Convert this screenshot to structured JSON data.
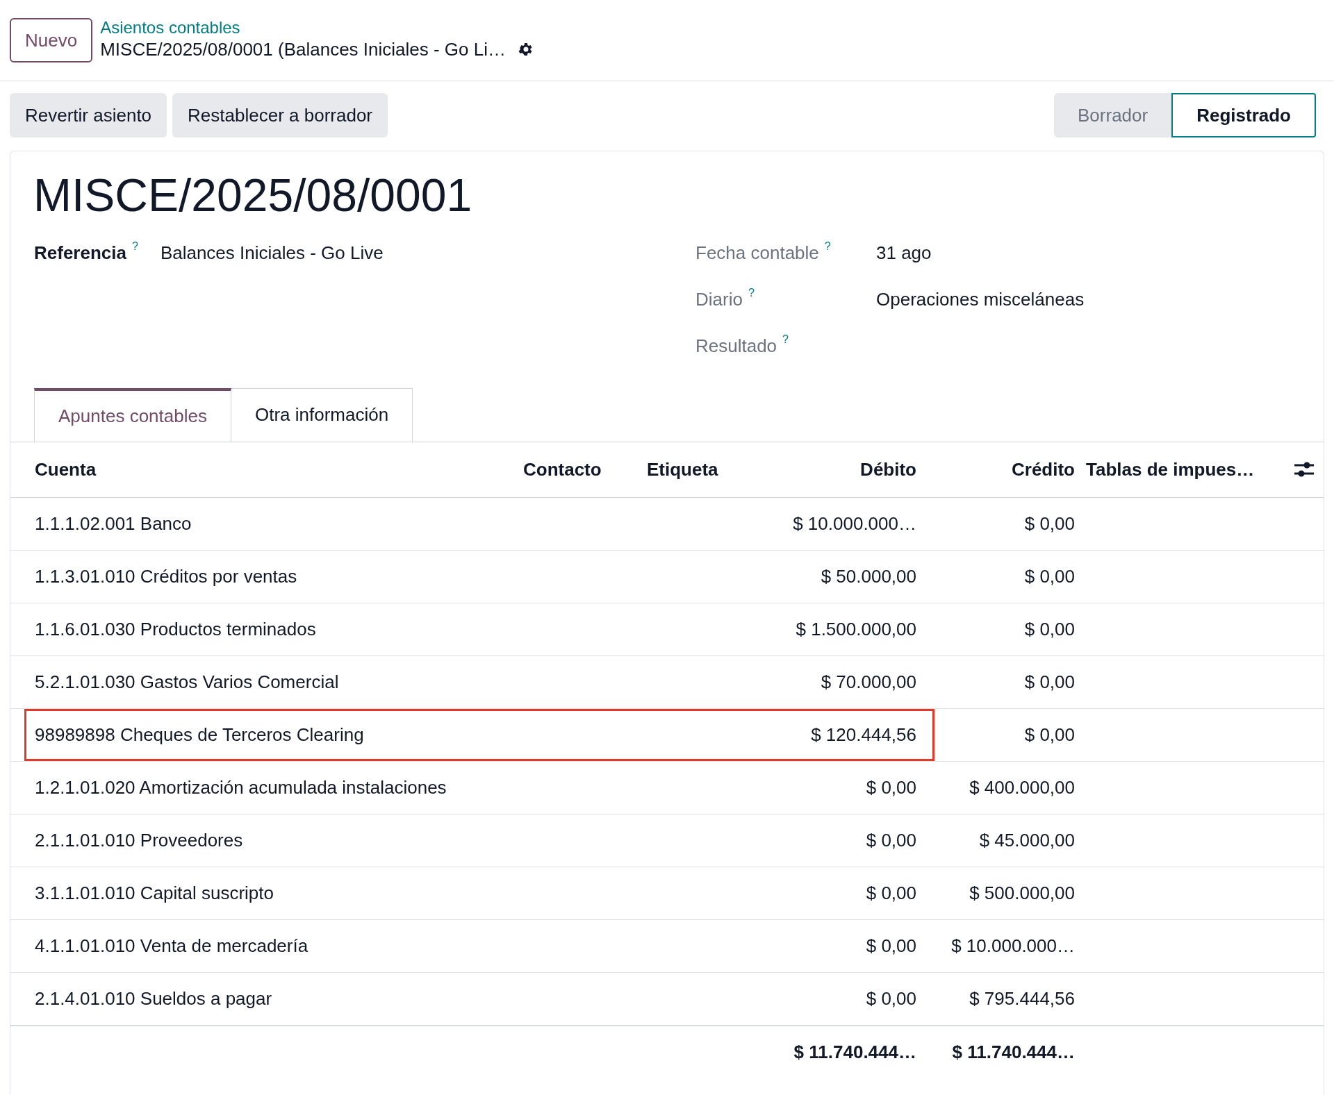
{
  "header": {
    "new_button": "Nuevo",
    "breadcrumb": "Asientos contables",
    "record_title": "MISCE/2025/08/0001 (Balances Iniciales - Go Li…"
  },
  "actions": [
    "Revertir asiento",
    "Restablecer a borrador"
  ],
  "stages": [
    {
      "label": "Borrador",
      "selected": false
    },
    {
      "label": "Registrado",
      "selected": true
    }
  ],
  "title": "MISCE/2025/08/0001",
  "fields_left": [
    {
      "label": "Referencia",
      "help": "?",
      "value": "Balances Iniciales - Go Live"
    }
  ],
  "fields_right": [
    {
      "label": "Fecha contable",
      "help": "?",
      "value": "31 ago"
    },
    {
      "label": "Diario",
      "help": "?",
      "value": "Operaciones misceláneas"
    },
    {
      "label": "Resultado",
      "help": "?"
    }
  ],
  "tabs": [
    {
      "label": "Apuntes contables",
      "selected": true
    },
    {
      "label": "Otra información",
      "selected": false
    }
  ],
  "table": {
    "columns": [
      "Cuenta",
      "Contacto",
      "Etiqueta",
      "Débito",
      "Crédito",
      "Tablas de impues…"
    ],
    "rows": [
      {
        "account": "1.1.1.02.001 Banco",
        "debit": "$ 10.000.000…",
        "credit": "$ 0,00",
        "highlighted": false
      },
      {
        "account": "1.1.3.01.010 Créditos por ventas",
        "debit": "$ 50.000,00",
        "credit": "$ 0,00",
        "highlighted": false
      },
      {
        "account": "1.1.6.01.030 Productos terminados",
        "debit": "$ 1.500.000,00",
        "credit": "$ 0,00",
        "highlighted": false
      },
      {
        "account": "5.2.1.01.030 Gastos Varios Comercial",
        "debit": "$ 70.000,00",
        "credit": "$ 0,00",
        "highlighted": false
      },
      {
        "account": "98989898 Cheques de Terceros Clearing",
        "debit": "$ 120.444,56",
        "credit": "$ 0,00",
        "highlighted": true
      },
      {
        "account": "1.2.1.01.020 Amortización acumulada instalaciones",
        "debit": "$ 0,00",
        "credit": "$ 400.000,00",
        "highlighted": false
      },
      {
        "account": "2.1.1.01.010 Proveedores",
        "debit": "$ 0,00",
        "credit": "$ 45.000,00",
        "highlighted": false
      },
      {
        "account": "3.1.1.01.010 Capital suscripto",
        "debit": "$ 0,00",
        "credit": "$ 500.000,00",
        "highlighted": false
      },
      {
        "account": "4.1.1.01.010 Venta de mercadería",
        "debit": "$ 0,00",
        "credit": "$ 10.000.000…",
        "highlighted": false
      },
      {
        "account": "2.1.4.01.010 Sueldos a pagar",
        "debit": "$ 0,00",
        "credit": "$ 795.444,56",
        "highlighted": false
      }
    ],
    "totals": {
      "debit": "$ 11.740.444…",
      "credit": "$ 11.740.444…"
    }
  }
}
